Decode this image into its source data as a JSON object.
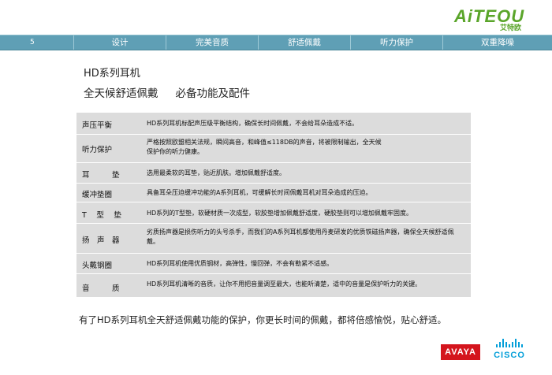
{
  "logo": {
    "wordmark": "AiTEOU",
    "subtitle": "艾特欧"
  },
  "nav": {
    "page_number": "5",
    "items": [
      "设计",
      "完美音质",
      "舒适佩戴",
      "听力保护",
      "双重降噪"
    ]
  },
  "heading": {
    "title": "HD系列耳机",
    "subtitle_a": "全天候舒适佩戴",
    "subtitle_b": "必备功能及配件"
  },
  "spec_table": [
    {
      "label": "声压平衡",
      "desc": "HD系列耳机标配声压级平衡结构，确保长时间佩戴，不会给耳朵造成不适。"
    },
    {
      "label": "听力保护",
      "desc": "严格按照欧盟相关法规，瞬间高音，和峰值≤118DB的声音，将被限制输出，全天候保护你的听力健康。"
    },
    {
      "label": "耳　　　垫",
      "desc": "选用最柔软的耳垫，贴近肌肤。增加佩戴舒适度。"
    },
    {
      "label": "缓冲垫圈",
      "desc": "具备耳朵压迫缓冲功能的A系列耳机，可缓解长时间佩戴耳机对耳朵造成的压迫。"
    },
    {
      "label": "T　 型　 垫",
      "desc": "HD系列的T型垫，软硬材质一次成型，软胶垫增加佩戴舒适度，硬胶垫则可以增加佩戴牢固度。"
    },
    {
      "label": "扬　声　器",
      "desc": "劣质扬声器是损伤听力的头号杀手，而我们的A系列耳机都使用丹麦研发的优质铁磁扬声器，确保全天候舒适佩戴。"
    },
    {
      "label": "头戴钢圈",
      "desc": "HD系列耳机使用优质钢材，高弹性，慢回弹，不会有勒紧不适感。"
    },
    {
      "label": "音　　　质",
      "desc": "HD系列耳机清晰的音质，让你不用把音量调至最大，也能听清楚，适中的音量是保护听力的关键。"
    }
  ],
  "footer_text": "有了HD系列耳机全天舒适佩戴功能的保护，你更长时间的佩戴，都将倍感愉悦，贴心舒适。",
  "partners": {
    "avaya": "AVAYA",
    "cisco": "CISCO"
  },
  "colors": {
    "nav_bar": "#5f9fb5",
    "logo_green": "#5aa52a",
    "avaya_red": "#d4151d",
    "cisco_blue": "#049fd9",
    "table_bg": "#dcdcdc"
  }
}
